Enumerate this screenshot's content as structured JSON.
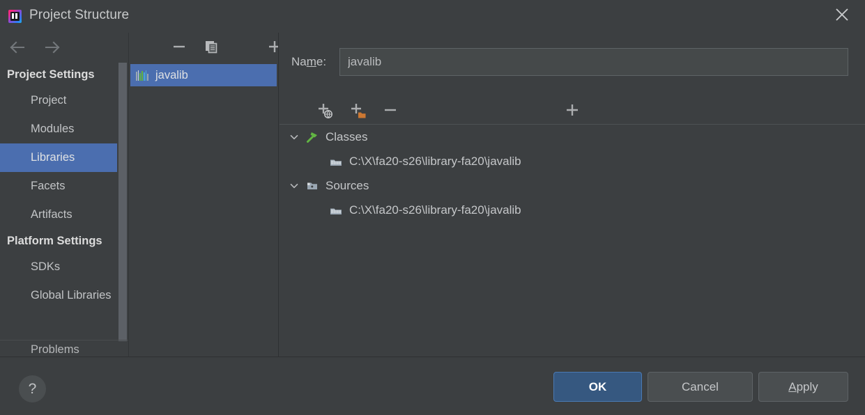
{
  "window": {
    "title": "Project Structure",
    "app_icon": "intellij-idea-icon",
    "close_icon": "close-icon"
  },
  "sidebar": {
    "back_icon": "arrow-left-icon",
    "forward_icon": "arrow-right-icon",
    "groups": [
      {
        "label": "Project Settings",
        "items": [
          {
            "label": "Project",
            "selected": false
          },
          {
            "label": "Modules",
            "selected": false
          },
          {
            "label": "Libraries",
            "selected": true
          },
          {
            "label": "Facets",
            "selected": false
          },
          {
            "label": "Artifacts",
            "selected": false
          }
        ]
      },
      {
        "label": "Platform Settings",
        "items": [
          {
            "label": "SDKs",
            "selected": false
          },
          {
            "label": "Global Libraries",
            "selected": false
          }
        ]
      }
    ],
    "bottom_item": {
      "label": "Problems"
    }
  },
  "library_list": {
    "toolbar": [
      {
        "name": "add-library-button",
        "icon": "plus-icon",
        "label": "+"
      },
      {
        "name": "remove-library-button",
        "icon": "minus-icon",
        "label": "−"
      },
      {
        "name": "copy-library-button",
        "icon": "copy-icon",
        "label": ""
      }
    ],
    "items": [
      {
        "label": "javalib",
        "icon": "library-icon",
        "selected": true
      }
    ]
  },
  "detail": {
    "name_field": {
      "label_before": "Na",
      "label_mnemonic": "m",
      "label_after": "e:",
      "value": "javalib",
      "placeholder": ""
    },
    "toolbar": [
      {
        "name": "add-path-button",
        "icon": "plus-icon",
        "label": "+"
      },
      {
        "name": "add-url-button",
        "icon": "plus-globe-icon",
        "label": "+"
      },
      {
        "name": "add-jar-directory-button",
        "icon": "plus-folder-icon",
        "label": "+"
      },
      {
        "name": "remove-path-button",
        "icon": "minus-icon",
        "label": "−"
      }
    ],
    "tree": [
      {
        "label": "Classes",
        "icon": "classes-hammer-icon",
        "expanded": true,
        "twisty": "chevron-down-icon",
        "children": [
          {
            "label": "C:\\X\\fa20-s26\\library-fa20\\javalib",
            "icon": "jar-archive-icon"
          }
        ]
      },
      {
        "label": "Sources",
        "icon": "sources-folder-icon",
        "expanded": true,
        "twisty": "chevron-down-icon",
        "children": [
          {
            "label": "C:\\X\\fa20-s26\\library-fa20\\javalib",
            "icon": "jar-archive-icon"
          }
        ]
      }
    ]
  },
  "footer": {
    "help_label": "?",
    "ok_label": "OK",
    "cancel_label": "Cancel",
    "apply_mnemonic": "A",
    "apply_rest": "pply"
  },
  "colors": {
    "window_bg": "#3c3f41",
    "selection_blue": "#4b6eaf",
    "primary_button": "#365880",
    "text": "#c2c4c6",
    "icon_orange": "#cc7832",
    "icon_green": "#62b543"
  }
}
